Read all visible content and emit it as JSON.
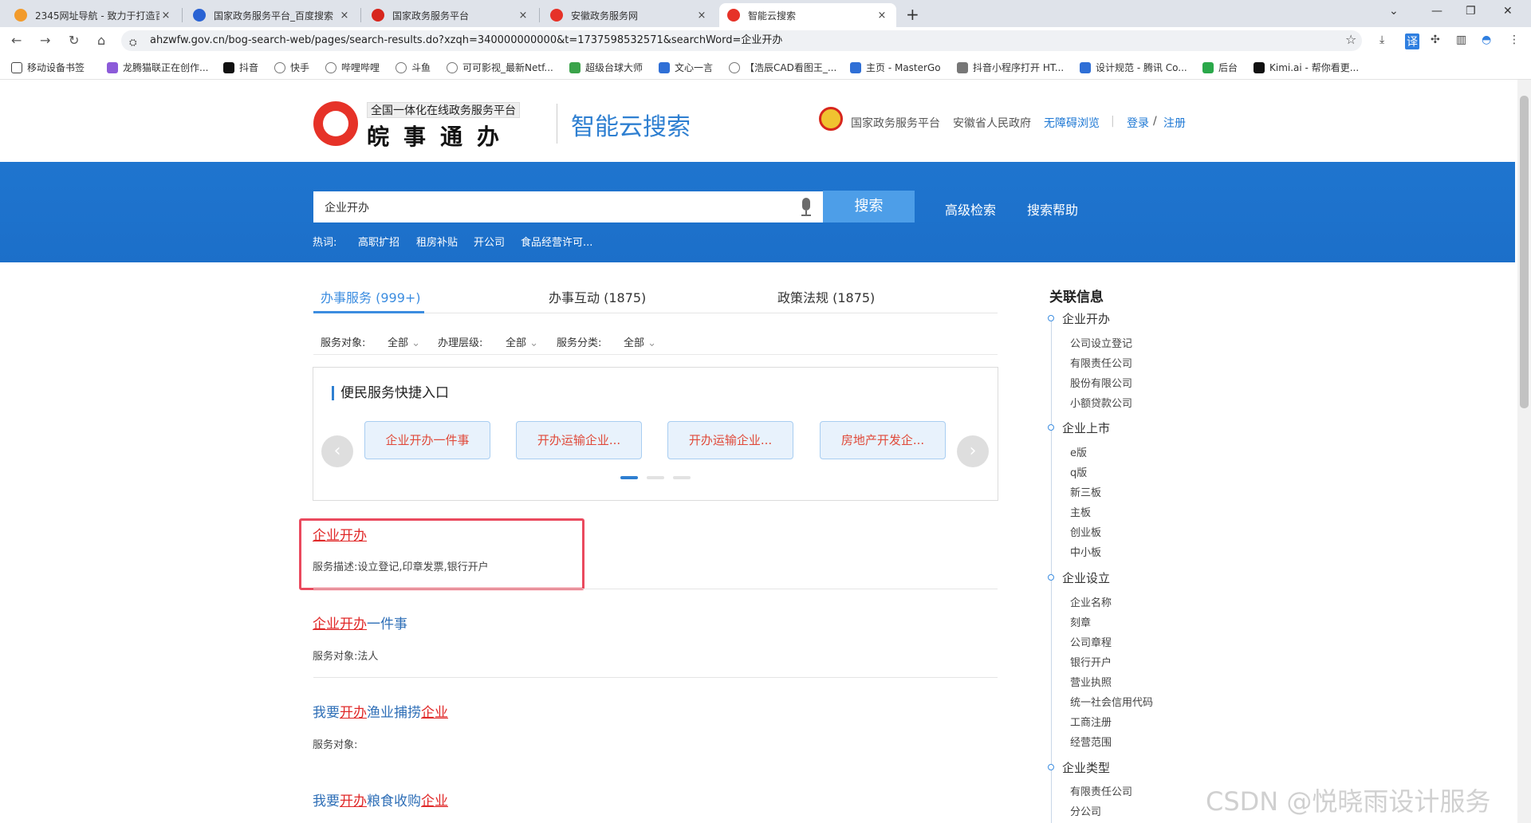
{
  "browser": {
    "tabs": [
      {
        "title": "2345网址导航 - 致力于打造百",
        "color": "#f29b2c"
      },
      {
        "title": "国家政务服务平台_百度搜索",
        "color": "#2a63d4"
      },
      {
        "title": "国家政务服务平台",
        "color": "#d7261d"
      },
      {
        "title": "安徽政务服务网",
        "color": "#e63228"
      },
      {
        "title": "智能云搜索",
        "color": "#e63228"
      }
    ],
    "close_glyph": "×",
    "new_tab_glyph": "+",
    "url": "ahzwfw.gov.cn/bog-search-web/pages/search-results.do?xzqh=340000000000&t=1737598532571&searchWord=企业开办",
    "bookmarks": [
      {
        "label": "移动设备书签",
        "color": "#444444"
      },
      {
        "label": "龙腾猫联正在创作...",
        "color": "#8c5bd9"
      },
      {
        "label": "抖音",
        "color": "#111111"
      },
      {
        "label": "快手",
        "color": "#777777"
      },
      {
        "label": "哔哩哔哩",
        "color": "#777777"
      },
      {
        "label": "斗鱼",
        "color": "#777777"
      },
      {
        "label": "可可影视_最新Netf...",
        "color": "#777777"
      },
      {
        "label": "超级台球大师",
        "color": "#3aa34a"
      },
      {
        "label": "文心一言",
        "color": "#2f6fd6"
      },
      {
        "label": "【浩辰CAD看图王_...",
        "color": "#777777"
      },
      {
        "label": "主页 - MasterGo",
        "color": "#2f6fd6"
      },
      {
        "label": "抖音小程序打开 HT...",
        "color": "#777777"
      },
      {
        "label": "设计规范 - 腾讯 Co...",
        "color": "#2f6fd6"
      },
      {
        "label": "后台",
        "color": "#2aa84a"
      },
      {
        "label": "Kimi.ai - 帮你看更...",
        "color": "#111111"
      }
    ]
  },
  "header": {
    "logo_sub": "全国一体化在线政务服务平台",
    "logo_main": "皖事通办",
    "title": "智能云搜索",
    "links": [
      "国家政务服务平台",
      "安徽省人民政府"
    ],
    "accessibility": "无障碍浏览",
    "login": "登录",
    "slash": "/",
    "register": "注册"
  },
  "search": {
    "value": "企业开办",
    "button": "搜索",
    "advanced": "高级检索",
    "help": "搜索帮助",
    "hot_label": "热词:",
    "hot_words": [
      "高职扩招",
      "租房补贴",
      "开公司",
      "食品经营许可..."
    ]
  },
  "tabs": [
    {
      "label": "办事服务 (999+)"
    },
    {
      "label": "办事互动 (1875)"
    },
    {
      "label": "政策法规 (1875)"
    }
  ],
  "filters": [
    {
      "label": "服务对象:",
      "value": "全部"
    },
    {
      "label": "办理层级:",
      "value": "全部"
    },
    {
      "label": "服务分类:",
      "value": "全部"
    }
  ],
  "quick": {
    "title": "便民服务快捷入口",
    "items": [
      "企业开办一件事",
      "开办运输企业...",
      "开办运输企业...",
      "房地产开发企..."
    ],
    "prev": "‹",
    "next": "›"
  },
  "results": [
    {
      "title": "企业开办",
      "desc": "服务描述:设立登记,印章发票,银行开户"
    },
    {
      "title_hl": "企业开办",
      "title_rest": "一件事",
      "desc": "服务对象:法人"
    },
    {
      "title_p1": "我要",
      "title_h1": "开办",
      "title_p2": "渔业捕捞",
      "title_h2": "企业",
      "desc": "服务对象:"
    },
    {
      "title_p1": "我要",
      "title_h1": "开办",
      "title_p2": "粮食收购",
      "title_h2": "企业"
    }
  ],
  "sidebar": {
    "title": "关联信息",
    "groups": [
      {
        "label": "企业开办",
        "items": [
          "公司设立登记",
          "有限责任公司",
          "股份有限公司",
          "小额贷款公司"
        ]
      },
      {
        "label": "企业上市",
        "items": [
          "e版",
          "q版",
          "新三板",
          "主板",
          "创业板",
          "中小板"
        ]
      },
      {
        "label": "企业设立",
        "items": [
          "企业名称",
          "刻章",
          "公司章程",
          "银行开户",
          "营业执照",
          "统一社会信用代码",
          "工商注册",
          "经营范围"
        ]
      },
      {
        "label": "企业类型",
        "items": [
          "有限责任公司",
          "分公司"
        ]
      }
    ]
  },
  "watermark": "CSDN @悦晓雨设计服务"
}
